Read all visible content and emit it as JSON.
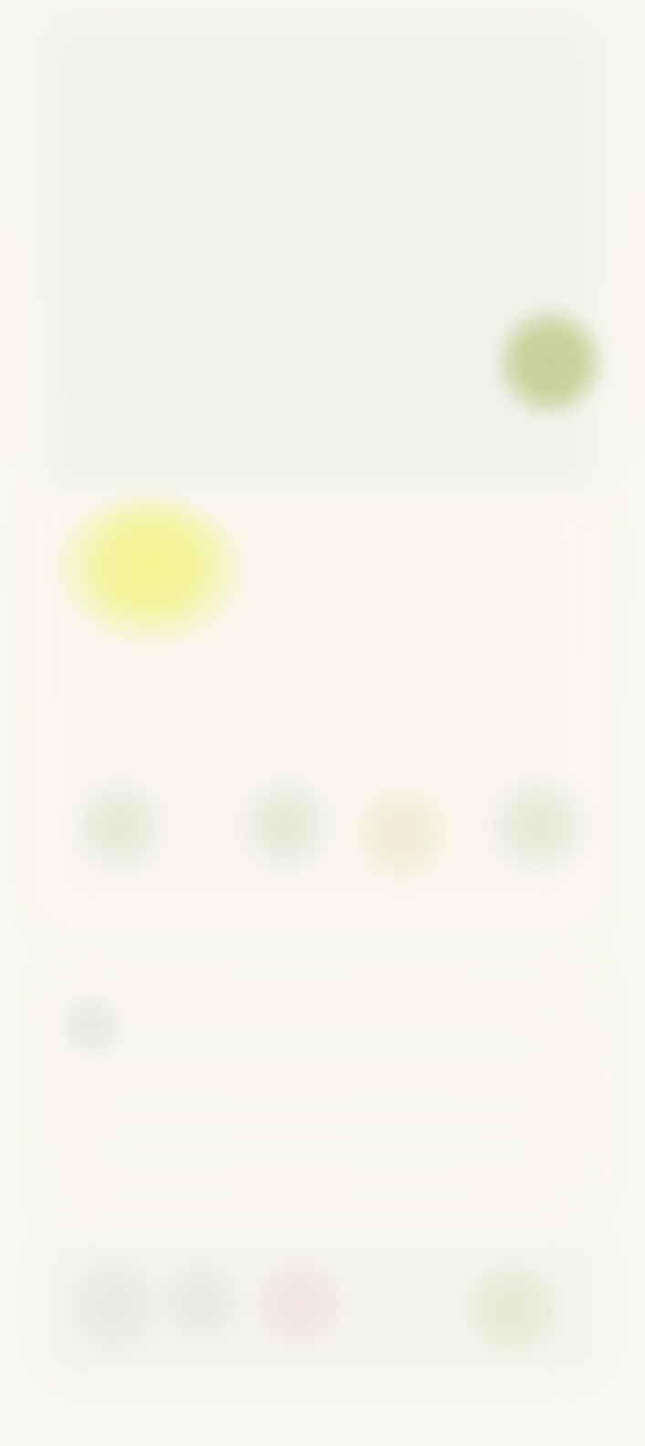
{
  "page": {
    "background": "#f7f6ef"
  },
  "colors": {
    "accent_green": "#c5cf9d",
    "accent_yellow": "#f4f58f",
    "accent_rose": "#f0e2db"
  }
}
